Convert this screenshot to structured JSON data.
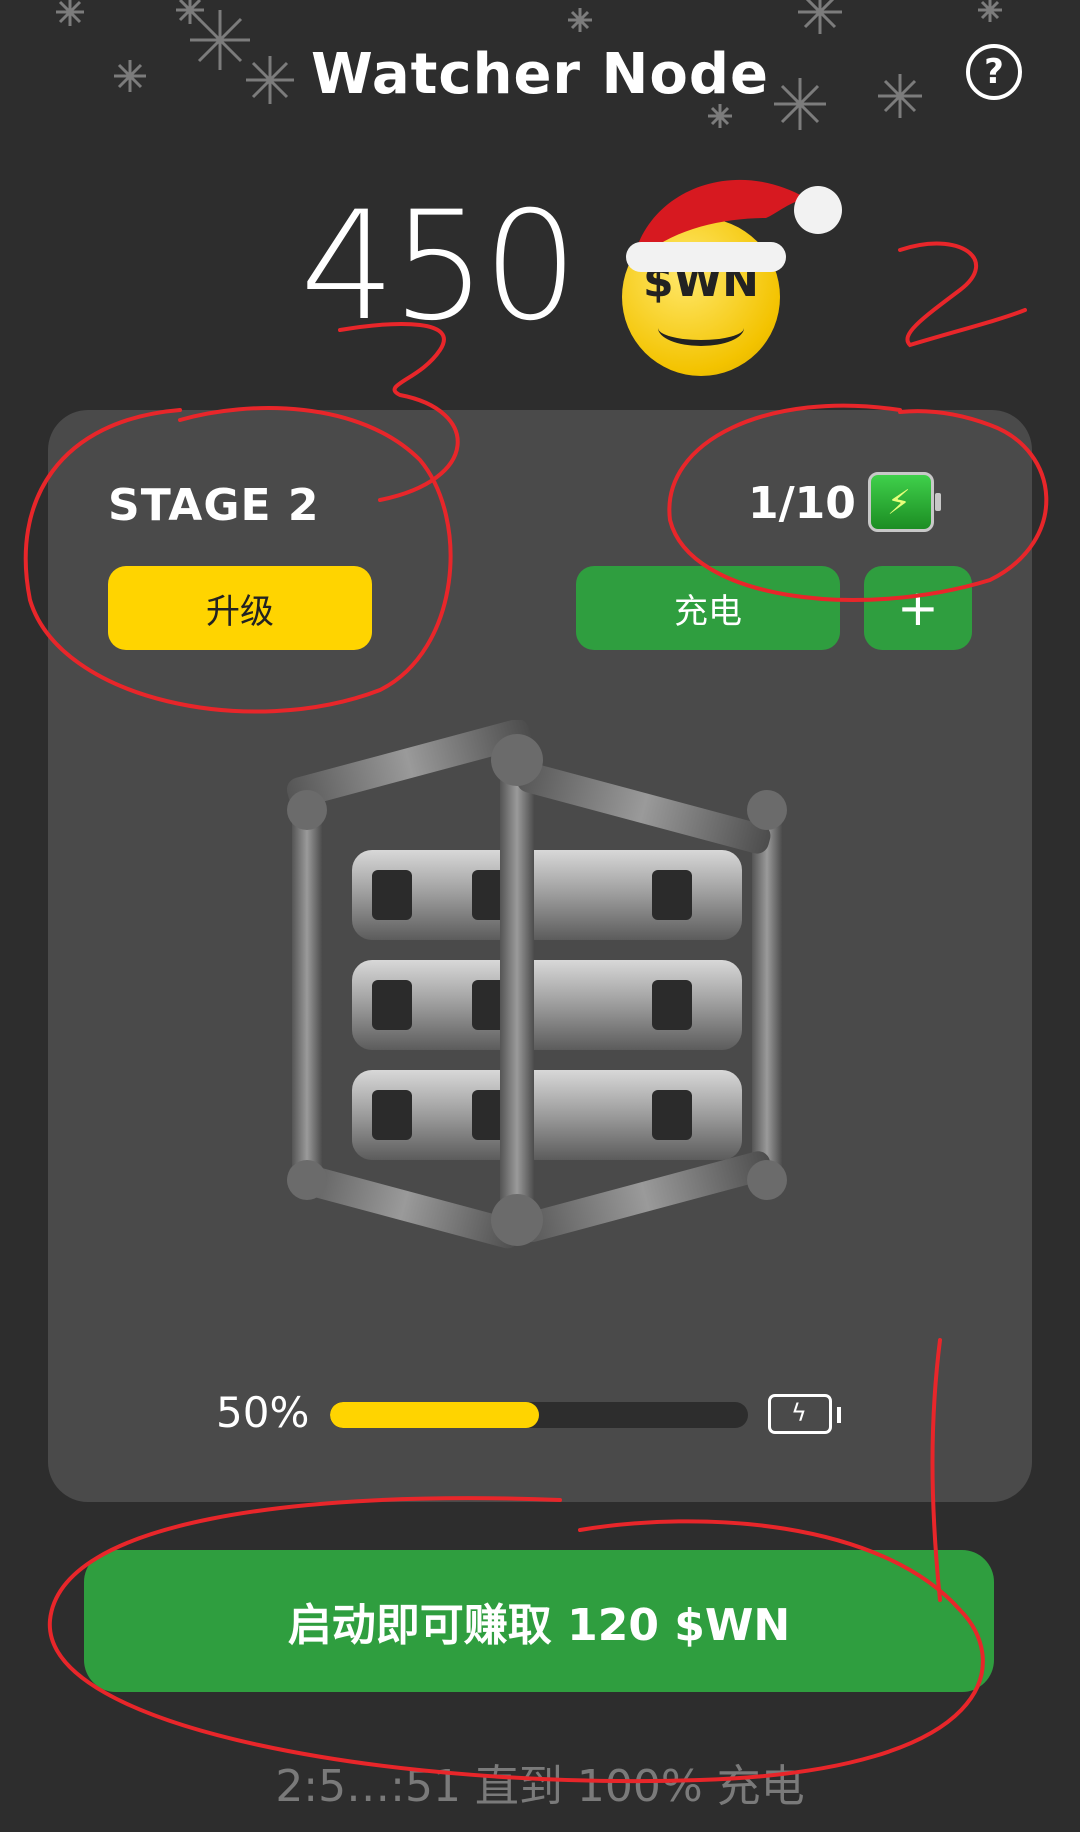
{
  "header": {
    "title": "Watcher Node",
    "help_icon": "question-circle-icon"
  },
  "balance": {
    "amount": "450",
    "token_label": "$WN",
    "decoration": "santa-hat"
  },
  "card": {
    "stage_label": "STAGE 2",
    "upgrade_label": "升级",
    "charge_count": "1/10",
    "charge_icon": "battery-charging-icon",
    "charge_label": "充电",
    "plus_label": "+",
    "miner_image": "miner-rig-image",
    "progress": {
      "percent_label": "50%",
      "value": 0.5,
      "icon": "battery-bolt-icon"
    }
  },
  "start_button": {
    "label": "启动即可赚取 120 $WN"
  },
  "timer": {
    "text": "2:5…:51 直到 100% 充电"
  },
  "colors": {
    "background": "#2d2d2d",
    "card": "#4a4a4a",
    "green": "#2f9e3f",
    "yellow": "#ffd400",
    "annotation": "#e8262a"
  },
  "annotations": {
    "labels": [
      "1",
      "2",
      "3"
    ]
  }
}
